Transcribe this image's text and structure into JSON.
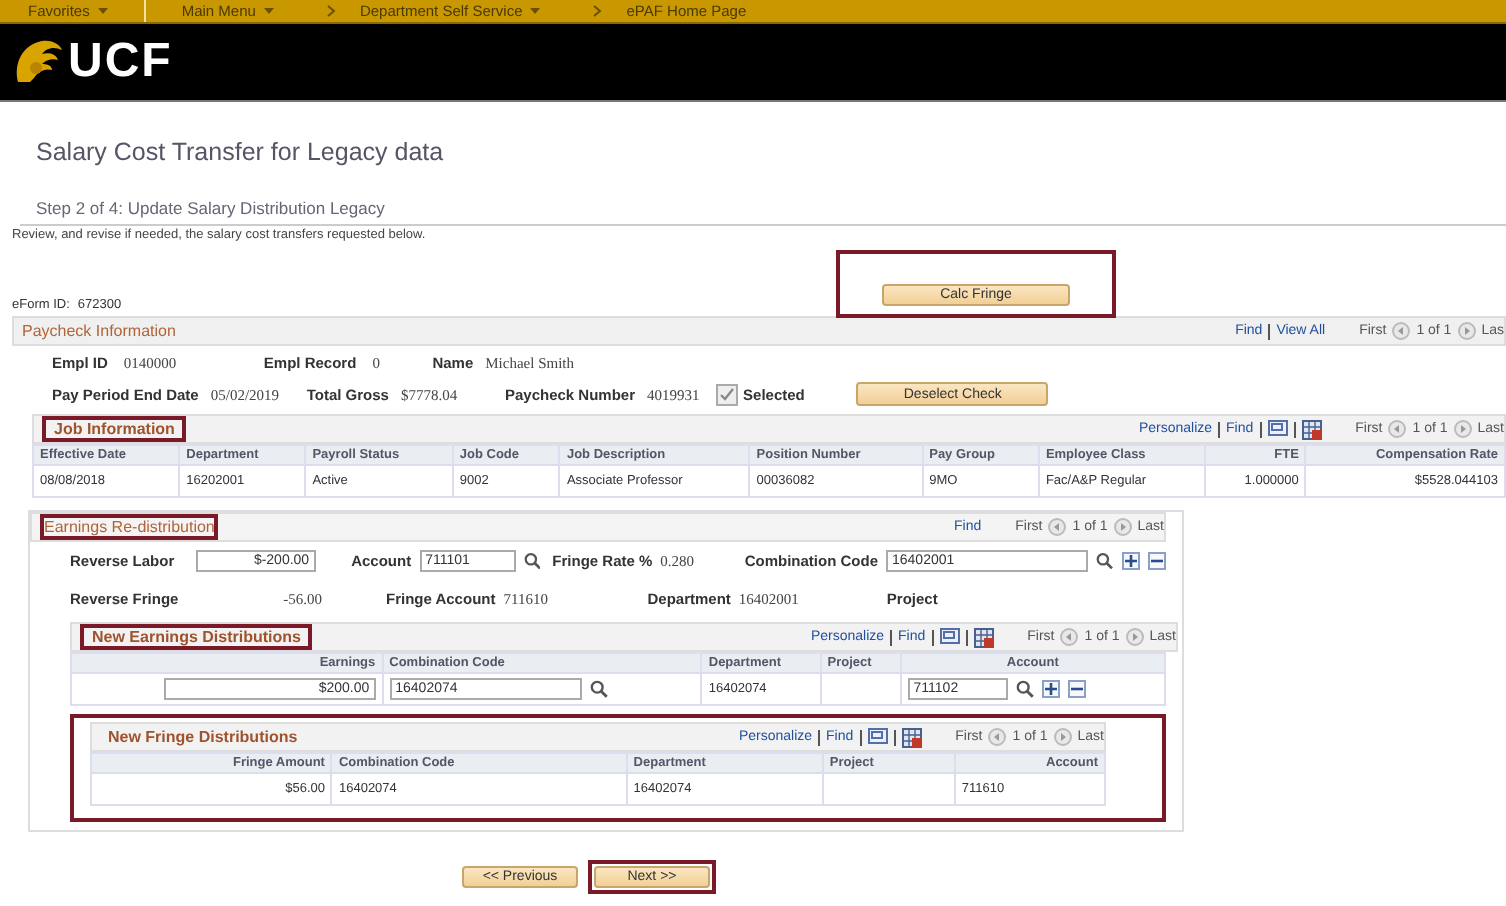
{
  "nav": [
    {
      "label": "Favorites",
      "dropdown": true,
      "chevron": false
    },
    {
      "label": "Main Menu",
      "dropdown": true,
      "chevron": false
    },
    {
      "label": "Department Self Service",
      "dropdown": true,
      "chevron": true
    },
    {
      "label": "ePAF Home Page",
      "dropdown": false,
      "chevron": true
    }
  ],
  "logo": "UCF",
  "title": "Salary Cost Transfer for Legacy data",
  "step": "Step 2 of 4: Update Salary Distribution Legacy",
  "instructions": "Review, and revise if needed, the salary cost transfers requested below.",
  "calc_button": {
    "label": "Calc Fringe",
    "highlighted": true
  },
  "eform": {
    "label": "eForm ID:",
    "value": "672300"
  },
  "paycheck": {
    "title": "Paycheck Information",
    "links": [
      "Find",
      "View All"
    ],
    "first": "First",
    "count": "1 of 1",
    "last": "Las",
    "fields1": [
      {
        "label": "Empl ID",
        "value": "0140000"
      },
      {
        "label": "Empl Record",
        "value": "0"
      },
      {
        "label": "Name",
        "value": "Michael Smith"
      }
    ],
    "fields2": [
      {
        "label": "Pay Period End Date",
        "value": "05/02/2019"
      },
      {
        "label": "Total Gross",
        "value": "$7778.04"
      },
      {
        "label": "Paycheck Number",
        "value": "4019931"
      }
    ],
    "selected": {
      "label": "Selected",
      "checked": true,
      "disabled": true
    },
    "deselect_button": "Deselect Check"
  },
  "job": {
    "title": "Job Information",
    "highlighted": true,
    "links": [
      "Personalize",
      "Find"
    ],
    "first": "First",
    "count": "1 of 1",
    "last": "Last",
    "columns": [
      "Effective Date",
      "Department",
      "Payroll Status",
      "Job Code",
      "Job Description",
      "Position Number",
      "Pay Group",
      "Employee Class",
      "FTE",
      "Compensation Rate"
    ],
    "rows": [
      [
        "08/08/2018",
        "16202001",
        "Active",
        "9002",
        "Associate Professor",
        "00036082",
        "9MO",
        "Fac/A&P Regular",
        "1.000000",
        "$5528.044103"
      ]
    ]
  },
  "earnings": {
    "title": "Earnings Re-distribution",
    "highlighted": true,
    "links": [
      "Find"
    ],
    "first": "First",
    "count": "1 of 1",
    "last": "Last",
    "reverse_labor": {
      "label": "Reverse Labor",
      "value": "$-200.00"
    },
    "account": {
      "label": "Account",
      "value": "711101"
    },
    "fringe_rate": {
      "label": "Fringe Rate %",
      "value": "0.280"
    },
    "combination_code": {
      "label": "Combination Code",
      "value": "16402001"
    },
    "reverse_fringe": {
      "label": "Reverse Fringe",
      "value": "-56.00"
    },
    "fringe_account": {
      "label": "Fringe Account",
      "value": "711610"
    },
    "department": {
      "label": "Department",
      "value": "16402001"
    },
    "project": {
      "label": "Project"
    }
  },
  "new_earnings": {
    "title": "New Earnings Distributions",
    "highlighted": true,
    "links": [
      "Personalize",
      "Find"
    ],
    "first": "First",
    "count": "1 of 1",
    "last": "Last",
    "columns": [
      "Earnings",
      "Combination Code",
      "Department",
      "Project",
      "Account"
    ],
    "rows": [
      {
        "earnings": "$200.00",
        "combination_code": "16402074",
        "department": "16402074",
        "account": "711102"
      }
    ]
  },
  "new_fringe": {
    "title": "New Fringe Distributions",
    "highlighted": true,
    "links": [
      "Personalize",
      "Find"
    ],
    "first": "First",
    "count": "1 of 1",
    "last": "Last",
    "columns": [
      "Fringe Amount",
      "Combination Code",
      "Department",
      "Project",
      "Account"
    ],
    "rows": [
      [
        "$56.00",
        "16402074",
        "16402074",
        "",
        "711610"
      ]
    ]
  },
  "buttons": [
    {
      "label": "<< Previous",
      "highlighted": false
    },
    {
      "label": "Next >>",
      "highlighted": true
    }
  ]
}
